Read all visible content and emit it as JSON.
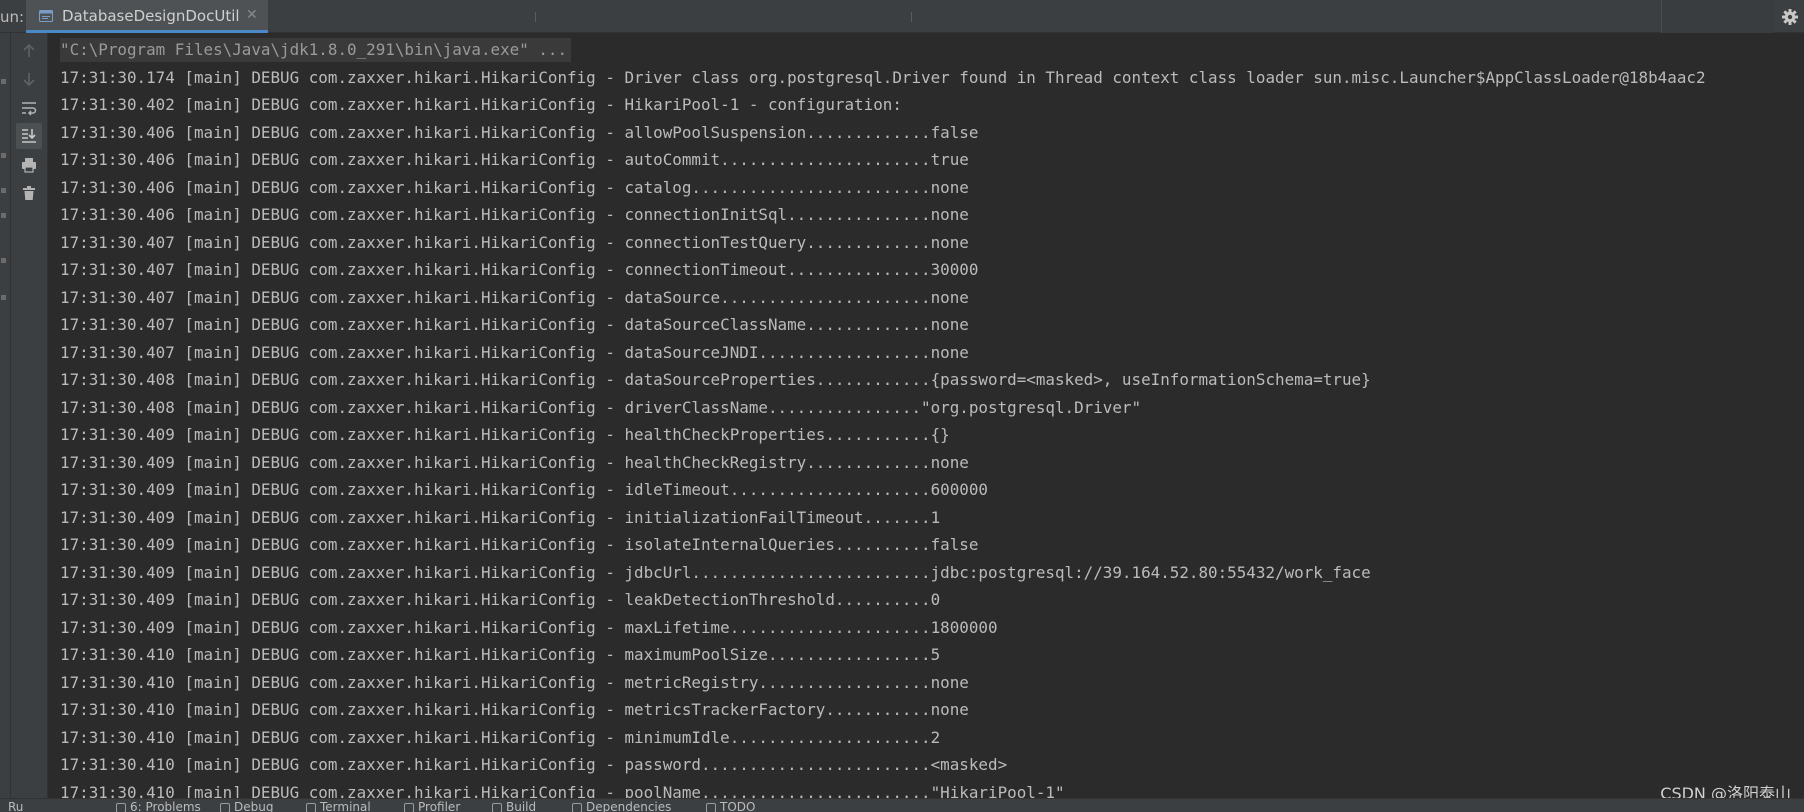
{
  "tabbar": {
    "run_label": "un:",
    "tab_title": "DatabaseDesignDocUtil",
    "tab_close": "✕"
  },
  "toolbar": {
    "tools": [
      "up-arrow-icon",
      "down-arrow-icon",
      "soft-wrap-icon",
      "scroll-to-end-icon",
      "print-icon",
      "trash-icon"
    ]
  },
  "console": {
    "command": "\"C:\\Program Files\\Java\\jdk1.8.0_291\\bin\\java.exe\" ...",
    "lines": [
      "17:31:30.174 [main] DEBUG com.zaxxer.hikari.HikariConfig - Driver class org.postgresql.Driver found in Thread context class loader sun.misc.Launcher$AppClassLoader@18b4aac2",
      "17:31:30.402 [main] DEBUG com.zaxxer.hikari.HikariConfig - HikariPool-1 - configuration:",
      "17:31:30.406 [main] DEBUG com.zaxxer.hikari.HikariConfig - allowPoolSuspension.............false",
      "17:31:30.406 [main] DEBUG com.zaxxer.hikari.HikariConfig - autoCommit......................true",
      "17:31:30.406 [main] DEBUG com.zaxxer.hikari.HikariConfig - catalog.........................none",
      "17:31:30.406 [main] DEBUG com.zaxxer.hikari.HikariConfig - connectionInitSql...............none",
      "17:31:30.407 [main] DEBUG com.zaxxer.hikari.HikariConfig - connectionTestQuery.............none",
      "17:31:30.407 [main] DEBUG com.zaxxer.hikari.HikariConfig - connectionTimeout...............30000",
      "17:31:30.407 [main] DEBUG com.zaxxer.hikari.HikariConfig - dataSource......................none",
      "17:31:30.407 [main] DEBUG com.zaxxer.hikari.HikariConfig - dataSourceClassName.............none",
      "17:31:30.407 [main] DEBUG com.zaxxer.hikari.HikariConfig - dataSourceJNDI..................none",
      "17:31:30.408 [main] DEBUG com.zaxxer.hikari.HikariConfig - dataSourceProperties............{password=<masked>, useInformationSchema=true}",
      "17:31:30.408 [main] DEBUG com.zaxxer.hikari.HikariConfig - driverClassName................\"org.postgresql.Driver\"",
      "17:31:30.409 [main] DEBUG com.zaxxer.hikari.HikariConfig - healthCheckProperties...........{}",
      "17:31:30.409 [main] DEBUG com.zaxxer.hikari.HikariConfig - healthCheckRegistry.............none",
      "17:31:30.409 [main] DEBUG com.zaxxer.hikari.HikariConfig - idleTimeout.....................600000",
      "17:31:30.409 [main] DEBUG com.zaxxer.hikari.HikariConfig - initializationFailTimeout.......1",
      "17:31:30.409 [main] DEBUG com.zaxxer.hikari.HikariConfig - isolateInternalQueries..........false",
      "17:31:30.409 [main] DEBUG com.zaxxer.hikari.HikariConfig - jdbcUrl.........................jdbc:postgresql://39.164.52.80:55432/work_face",
      "17:31:30.409 [main] DEBUG com.zaxxer.hikari.HikariConfig - leakDetectionThreshold..........0",
      "17:31:30.409 [main] DEBUG com.zaxxer.hikari.HikariConfig - maxLifetime.....................1800000",
      "17:31:30.410 [main] DEBUG com.zaxxer.hikari.HikariConfig - maximumPoolSize.................5",
      "17:31:30.410 [main] DEBUG com.zaxxer.hikari.HikariConfig - metricRegistry..................none",
      "17:31:30.410 [main] DEBUG com.zaxxer.hikari.HikariConfig - metricsTrackerFactory...........none",
      "17:31:30.410 [main] DEBUG com.zaxxer.hikari.HikariConfig - minimumIdle.....................2",
      "17:31:30.410 [main] DEBUG com.zaxxer.hikari.HikariConfig - password........................<masked>",
      "17:31:30.410 [main] DEBUG com.zaxxer.hikari.HikariConfig - poolName........................\"HikariPool-1\""
    ]
  },
  "watermark": "CSDN @洛阳泰山",
  "bottombar": {
    "items": [
      "Ru",
      "6: Problems",
      "Debug",
      "Terminal",
      "Profiler",
      "Build",
      "Dependencies",
      "TODO"
    ]
  }
}
